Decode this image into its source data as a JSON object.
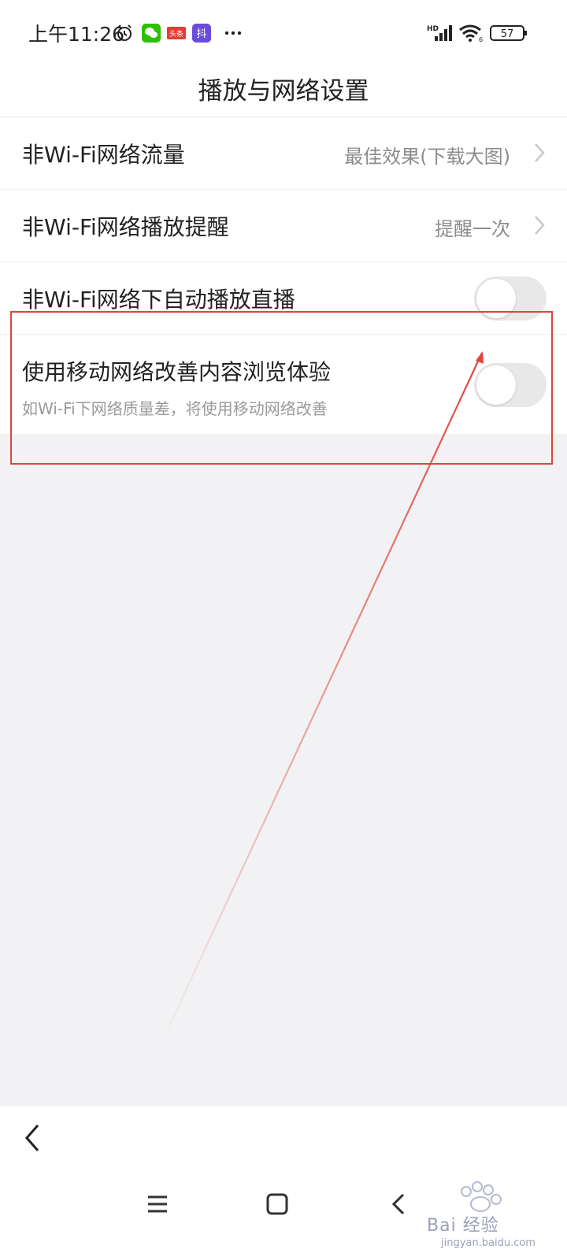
{
  "status_bar": {
    "time": "上午11:26",
    "icons": [
      "alarm-icon",
      "wechat-icon",
      "toutiao-icon",
      "douyin-icon",
      "more-dots-icon",
      "signal-icon",
      "wifi-icon",
      "battery-icon"
    ],
    "toutiao_label": "头条",
    "douyin_label": "抖",
    "network_label": "HD",
    "wifi_label": "6",
    "battery": "57"
  },
  "header": {
    "title": "播放与网络设置"
  },
  "settings": [
    {
      "title": "非Wi-Fi网络流量",
      "value": "最佳效果(下载大图)"
    },
    {
      "title": "非Wi-Fi网络播放提醒",
      "value": "提醒一次"
    },
    {
      "title": "非Wi-Fi网络下自动播放直播",
      "toggle": false
    },
    {
      "title": "使用移动网络改善内容浏览体验",
      "subtitle": "如Wi-Fi下网络质量差，将使用移动网络改善",
      "toggle": false
    }
  ],
  "watermark": {
    "text": "Bai 经验",
    "url": "jingyan.baidu.com"
  },
  "colors": {
    "highlight": "#e0443a",
    "toggle_off": "#e8e8e8",
    "muted_text": "#8c8c8c"
  }
}
